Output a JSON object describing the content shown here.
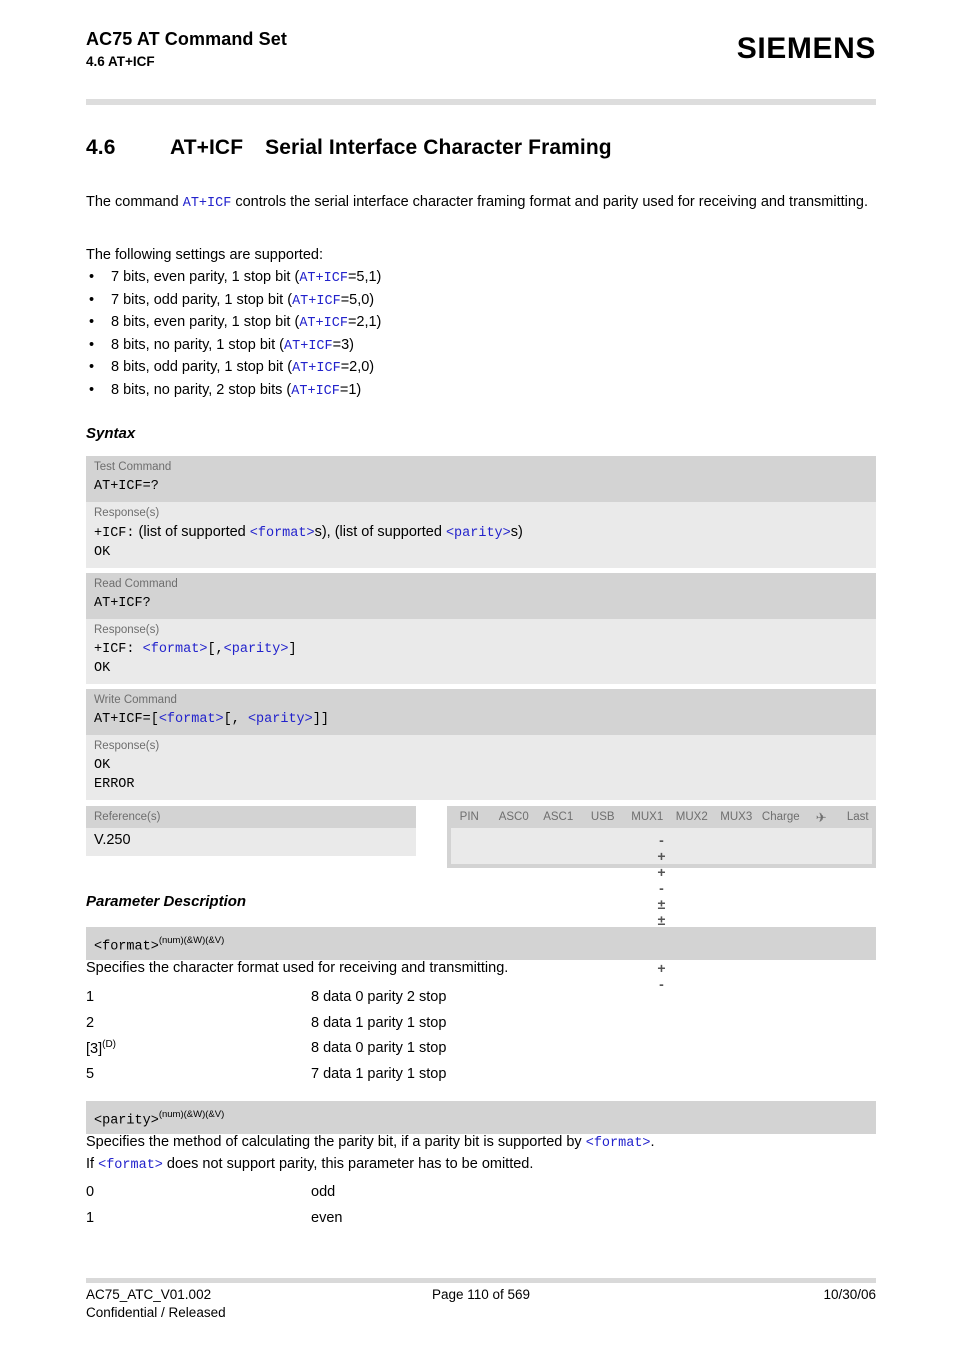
{
  "header": {
    "doc_title": "AC75 AT Command Set",
    "doc_section": "4.6 AT+ICF",
    "brand": "SIEMENS"
  },
  "section": {
    "number": "4.6",
    "command": "AT+ICF",
    "title": "Serial Interface Character Framing"
  },
  "intro": {
    "before": "The command ",
    "cmd": "AT+ICF",
    "after": " controls the serial interface character framing format and parity used for receiving and transmitting.",
    "supported_lead": "The following settings are supported:"
  },
  "bullets": [
    {
      "text_before": "7 bits, even parity, 1 stop bit (",
      "cmd": "AT+ICF",
      "text_after": "=5,1)"
    },
    {
      "text_before": "7 bits, odd parity, 1 stop bit (",
      "cmd": "AT+ICF",
      "text_after": "=5,0)"
    },
    {
      "text_before": "8 bits, even parity, 1 stop bit (",
      "cmd": "AT+ICF",
      "text_after": "=2,1)"
    },
    {
      "text_before": "8 bits, no parity, 1 stop bit (",
      "cmd": "AT+ICF",
      "text_after": "=3)"
    },
    {
      "text_before": "8 bits, odd parity, 1 stop bit (",
      "cmd": "AT+ICF",
      "text_after": "=2,0)"
    },
    {
      "text_before": "8 bits, no parity, 2 stop bits (",
      "cmd": "AT+ICF",
      "text_after": "=1)"
    }
  ],
  "bullet_glyph": "•",
  "headings": {
    "syntax": "Syntax",
    "parameter_description": "Parameter Description"
  },
  "syntax": {
    "test": {
      "label": "Test Command",
      "command": "AT+ICF=?",
      "response_label": "Response(s)",
      "resp_prefix": "+ICF:",
      "resp_t1": "(list of supported ",
      "resp_fmt": "<format>",
      "resp_t2": "s), (list of supported ",
      "resp_par": "<parity>",
      "resp_t3": "s)",
      "resp_ok": "OK"
    },
    "read": {
      "label": "Read Command",
      "command": "AT+ICF?",
      "response_label": "Response(s)",
      "resp_prefix": "+ICF:",
      "resp_fmt": "<format>",
      "resp_mid": "[,",
      "resp_par": "<parity>",
      "resp_end": "]",
      "resp_ok": "OK"
    },
    "write": {
      "label": "Write Command",
      "cmd_prefix": "AT+ICF=[",
      "cmd_fmt": "<format>",
      "cmd_mid": "[,",
      "cmd_par": "<parity>",
      "cmd_end": "]]",
      "response_label": "Response(s)",
      "resp_ok": "OK",
      "resp_error": "ERROR"
    }
  },
  "reference": {
    "label": "Reference(s)",
    "value": "V.250"
  },
  "pin_table": {
    "columns": [
      "PIN",
      "ASC0",
      "ASC1",
      "USB",
      "MUX1",
      "MUX2",
      "MUX3",
      "Charge",
      "airplane-icon",
      "Last"
    ],
    "airplane_glyph": "✈",
    "values": [
      "-",
      "+",
      "+",
      "-",
      "±",
      "±",
      "±",
      "-",
      "+",
      "-"
    ]
  },
  "parameters": [
    {
      "name": "<format>",
      "superscript": "(num)(&W)(&V)",
      "description": "Specifies the character format used for receiving and transmitting.",
      "values": [
        {
          "key": "1",
          "sup": "",
          "text": "8 data 0 parity 2 stop"
        },
        {
          "key": "2",
          "sup": "",
          "text": "8 data 1 parity 1 stop"
        },
        {
          "key": "[3]",
          "sup": "(D)",
          "text": "8 data 0 parity 1 stop"
        },
        {
          "key": "5",
          "sup": "",
          "text": "7 data 1 parity 1 stop"
        }
      ]
    },
    {
      "name": "<parity>",
      "superscript": "(num)(&W)(&V)",
      "desc_l1_a": "Specifies the method of calculating the parity bit, if a parity bit is supported by ",
      "desc_l1_fmt": "<format>",
      "desc_l1_b": ".",
      "desc_l2_a": "If ",
      "desc_l2_fmt": "<format>",
      "desc_l2_b": " does not support parity, this parameter has to be omitted.",
      "values": [
        {
          "key": "0",
          "sup": "",
          "text": "odd"
        },
        {
          "key": "1",
          "sup": "",
          "text": "even"
        }
      ]
    }
  ],
  "footer": {
    "doc_id": "AC75_ATC_V01.002",
    "page": "Page 110 of 569",
    "date": "10/30/06",
    "classification": "Confidential / Released"
  },
  "colors": {
    "link_blue": "#2222cc",
    "band_dark": "#d3d3d3",
    "band_light": "#eaeaea",
    "label_gray": "#6e6e6e"
  }
}
